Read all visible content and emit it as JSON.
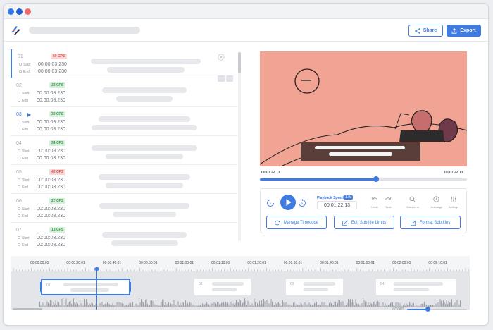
{
  "header": {
    "share_label": "Share",
    "export_label": "Export"
  },
  "subtitles": [
    {
      "num": "01",
      "cps": "60 CPS",
      "cps_kind": "bad",
      "start_label": "Start",
      "end_label": "End",
      "start": "00:00:03.230",
      "end": "00:00:03.230",
      "active": true
    },
    {
      "num": "02",
      "cps": "23 CPS",
      "cps_kind": "good",
      "start_label": "Start",
      "end_label": "End",
      "start": "00:00:03.230",
      "end": "00:00:03.230",
      "active": false
    },
    {
      "num": "03",
      "cps": "32 CPS",
      "cps_kind": "good",
      "start_label": "Start",
      "end_label": "End",
      "start": "00:00:03.230",
      "end": "00:00:03.230",
      "active": false,
      "playing": true
    },
    {
      "num": "04",
      "cps": "34 CPS",
      "cps_kind": "good",
      "start_label": "Start",
      "end_label": "End",
      "start": "00:00:03.230",
      "end": "00:00:03.230",
      "active": false
    },
    {
      "num": "05",
      "cps": "42 CPS",
      "cps_kind": "bad",
      "start_label": "Start",
      "end_label": "End",
      "start": "00:00:03.230",
      "end": "00:00:03.230",
      "active": false
    },
    {
      "num": "06",
      "cps": "27 CPS",
      "cps_kind": "good",
      "start_label": "Start",
      "end_label": "End",
      "start": "00:00:03.230",
      "end": "00:00:03.230",
      "active": false
    },
    {
      "num": "07",
      "cps": "18 CPS",
      "cps_kind": "good",
      "start_label": "Start",
      "end_label": "End",
      "start": "00:00:03.230",
      "end": "00:00:03.230",
      "active": false
    }
  ],
  "player": {
    "time_left": "00.01.22.13",
    "time_right": "00.01.22.13",
    "progress": 0.56,
    "playback_speed_label": "Playback Speed",
    "playback_speed": "1.0x",
    "current_timecode": "00:01:22.13",
    "tools": [
      "Undo",
      "Redo",
      "Waveform",
      "Autoalign",
      "Settings"
    ],
    "manage_timecode": "Manage Timecode",
    "edit_limits": "Edit Subtitle Limits",
    "format_subtitles": "Format Subtitles"
  },
  "timeline": {
    "ticks": [
      "00:00:00.01",
      "00:00:30.01",
      "00:00:40.01",
      "00:00:50.01",
      "00:01:00.01",
      "00:01:10.01",
      "00:01:20.01",
      "00:01:30.01",
      "00:01:40.01",
      "00:01:50.01",
      "00:02:00.01",
      "00:02:10.01"
    ],
    "clips": [
      "01",
      "02",
      "03",
      "04"
    ],
    "zoom_label": "Zoom",
    "zoom_level": 0.35
  },
  "colors": {
    "accent": "#3f7be0",
    "bad_cps_bg": "#f8d7d7",
    "bad_cps_fg": "#d9534f",
    "good_cps_bg": "#d6f0d9",
    "good_cps_fg": "#3a9d4f",
    "video_bg": "#f1a394"
  }
}
